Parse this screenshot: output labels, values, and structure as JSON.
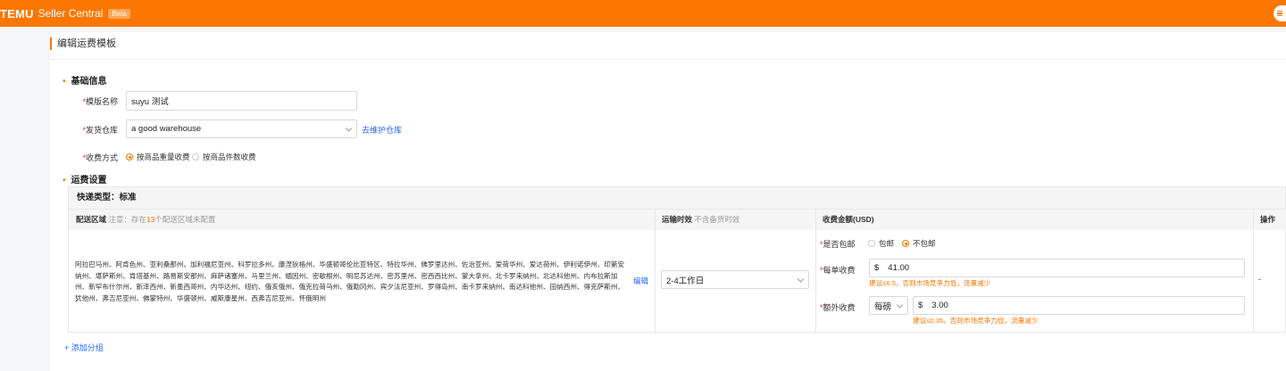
{
  "app": {
    "brand": "TEMU",
    "name": "Seller Central",
    "badge": "Beta"
  },
  "page": {
    "title": "编辑运费模板"
  },
  "basic": {
    "title": "基础信息",
    "template_name_label": "模版名称",
    "template_name_value": "suyu 测试",
    "warehouse_label": "发货仓库",
    "warehouse_value": "a good warehouse",
    "warehouse_link": "去维护仓库",
    "charge_label": "收费方式",
    "charge_options": [
      "按商品重量收费",
      "按商品件数收费"
    ],
    "charge_selected": 0
  },
  "shipping": {
    "title": "运费设置",
    "express_type": "快递类型：标准",
    "col_region": "配送区域",
    "col_region_note_prefix": "注意：存在",
    "col_region_note_num": "13",
    "col_region_note_suffix": "个配送区域未配置",
    "col_time": "运输时效",
    "col_time_note": "不含备货时效",
    "col_fee": "收费金额(USD)",
    "col_action": "操作",
    "row": {
      "regions": "阿拉巴马州、阿肯色州、亚利桑那州、加利福尼亚州、科罗拉多州、康涅狄格州、华盛顿哥伦比亚特区、特拉华州、佛罗里达州、佐治亚州、爱荷华州、爱达荷州、伊利诺伊州、印第安纳州、堪萨斯州、肯塔基州、路易斯安那州、麻萨诸塞州、马里兰州、缅因州、密歇根州、明尼苏达州、密苏里州、密西西比州、蒙大拿州、北卡罗来纳州、北达科他州、内布拉斯加州、新罕布什尔州、新泽西州、新墨西哥州、内华达州、纽约、俄亥俄州、俄克拉荷马州、俄勒冈州、宾夕法尼亚州、罗得岛州、南卡罗来纳州、南达科他州、田纳西州、得克萨斯州、犹他州、弗吉尼亚州、佛蒙特州、华盛顿州、威斯康星州、西弗吉尼亚州、怀俄明州",
      "edit_link": "编辑",
      "time_value": "2-4工作日",
      "free_label": "是否包邮",
      "free_options": [
        "包邮",
        "不包邮"
      ],
      "free_selected": 1,
      "per_order_label": "每单收费",
      "currency": "$",
      "per_order_value": "41.00",
      "per_order_hint": "建议≤6.5，否则市场竞争力低，流量减少",
      "extra_label": "额外收费",
      "extra_unit": "每磅",
      "extra_value": "3.00",
      "extra_hint": "建议≤0.35，否则市场竞争力低，流量减少",
      "action": "-"
    },
    "add_group": "添加分组"
  }
}
